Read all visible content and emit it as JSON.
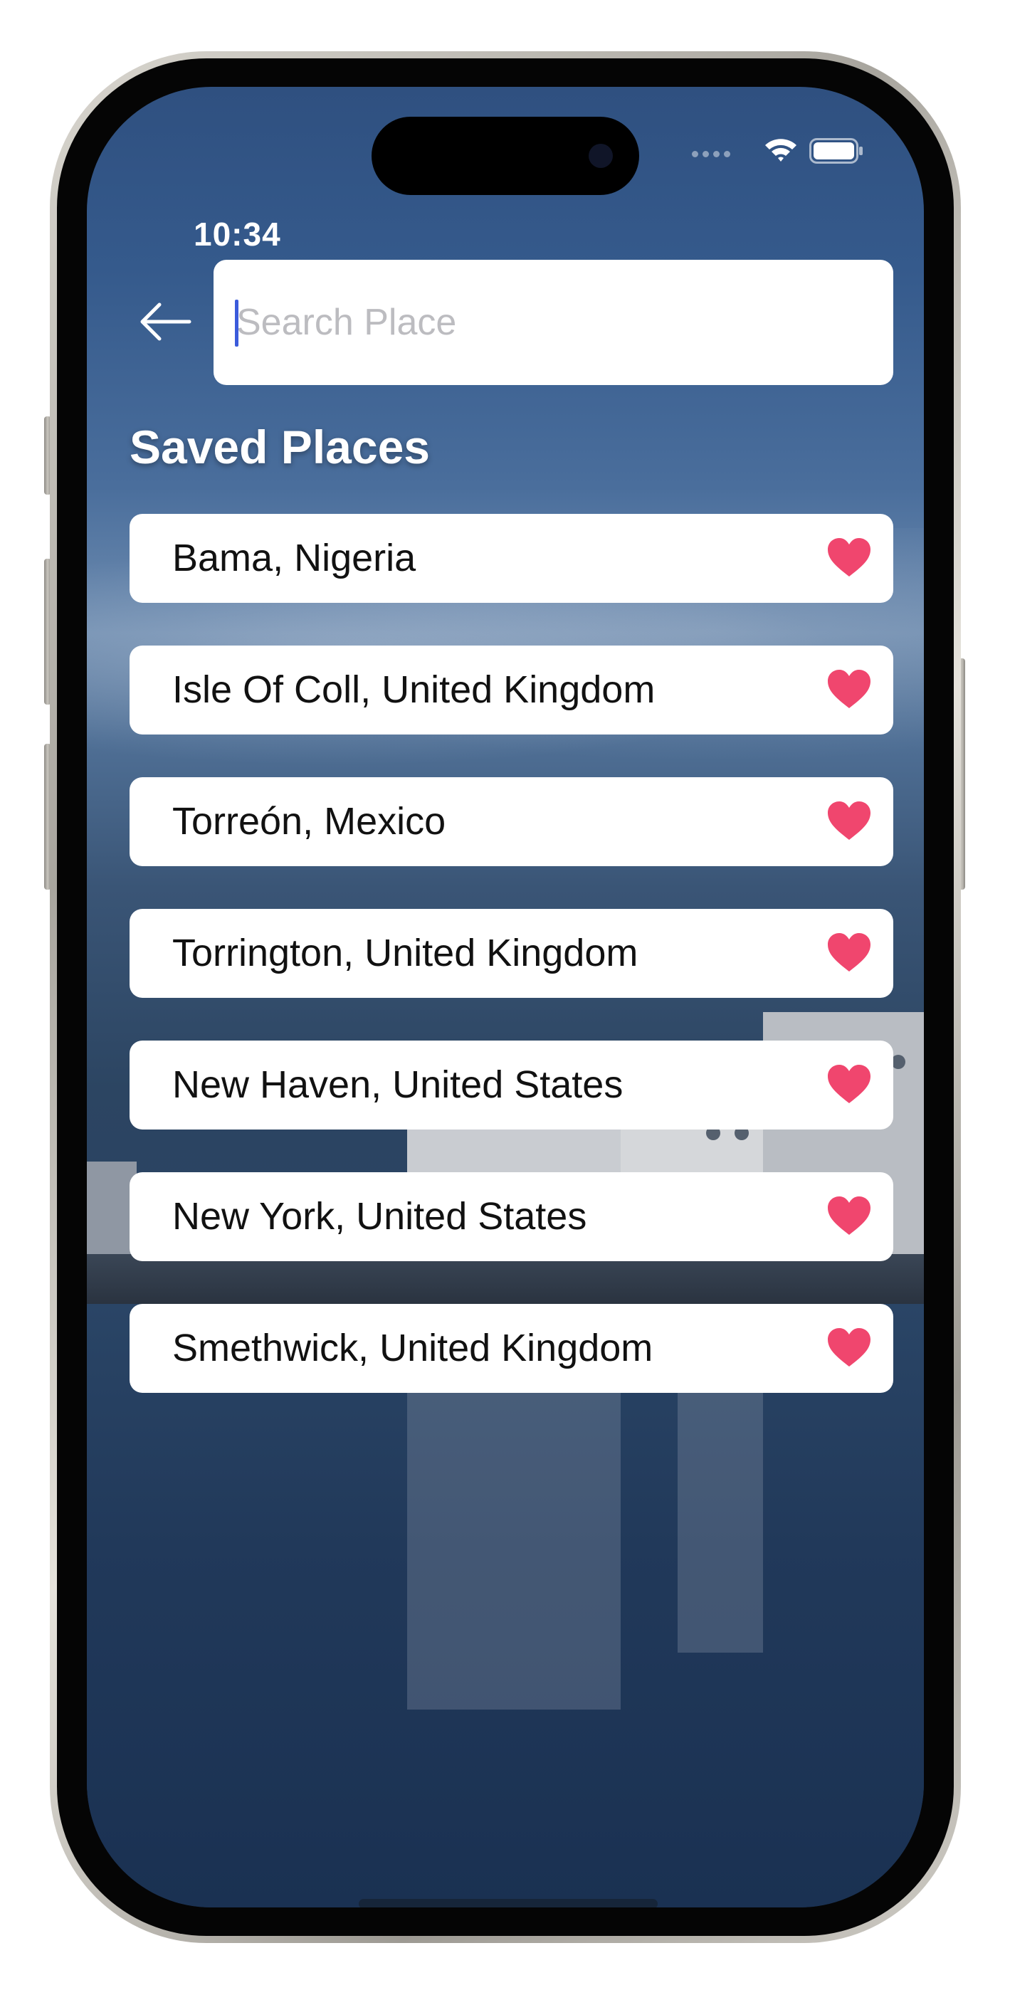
{
  "status_bar": {
    "time": "10:34",
    "icons": [
      "cellular-dots-icon",
      "wifi-icon",
      "battery-icon"
    ]
  },
  "header": {
    "back_icon": "arrow-left-icon",
    "search": {
      "placeholder": "Search Place",
      "value": ""
    }
  },
  "saved": {
    "title": "Saved Places",
    "items": [
      {
        "label": "Bama, Nigeria",
        "icon": "heart-icon"
      },
      {
        "label": "Isle Of Coll, United Kingdom",
        "icon": "heart-icon"
      },
      {
        "label": "Torreón, Mexico",
        "icon": "heart-icon"
      },
      {
        "label": "Torrington, United Kingdom",
        "icon": "heart-icon"
      },
      {
        "label": "New Haven, United States",
        "icon": "heart-icon"
      },
      {
        "label": "New York, United States",
        "icon": "heart-icon"
      },
      {
        "label": "Smethwick, United Kingdom",
        "icon": "heart-icon"
      }
    ]
  },
  "colors": {
    "heart": "#f0466e",
    "caret": "#3b5bdb",
    "card": "#ffffff",
    "background_sky": "#355a8c"
  }
}
